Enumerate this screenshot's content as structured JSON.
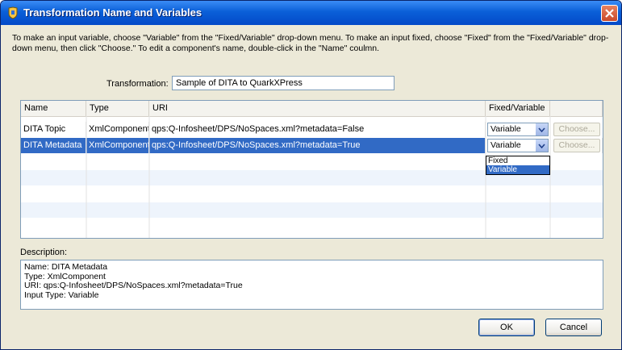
{
  "window": {
    "title": "Transformation Name and Variables"
  },
  "instructions": "To make an input variable, choose \"Variable\" from the \"Fixed/Variable\" drop-down menu. To make an input fixed, choose \"Fixed\" from the \"Fixed/Variable\" drop-down menu, then click \"Choose.\" To edit a component's name, double-click in the \"Name\" coulmn.",
  "transformation": {
    "label": "Transformation:",
    "value": "Sample of DITA to QuarkXPress"
  },
  "grid": {
    "columns": [
      "Name",
      "Type",
      "URI",
      "Fixed/Variable",
      ""
    ],
    "rows": [
      {
        "name": "DITA Topic",
        "type": "XmlComponent",
        "uri": "qps:Q-Infosheet/DPS/NoSpaces.xml?metadata=False",
        "mode": "Variable",
        "choose": "Choose..."
      },
      {
        "name": "DITA Metadata",
        "type": "XmlComponent",
        "uri": "qps:Q-Infosheet/DPS/NoSpaces.xml?metadata=True",
        "mode": "Variable",
        "choose": "Choose..."
      }
    ],
    "dropdown_options": [
      "Fixed",
      "Variable"
    ]
  },
  "description": {
    "label": "Description:",
    "lines": [
      "Name: DITA Metadata",
      "Type: XmlComponent",
      "URI: qps:Q-Infosheet/DPS/NoSpaces.xml?metadata=True",
      "Input Type: Variable"
    ]
  },
  "buttons": {
    "ok": "OK",
    "cancel": "Cancel"
  },
  "colors": {
    "titlebar": "#0a5fd8",
    "selection": "#316ac5",
    "dialog_bg": "#ece9d8"
  }
}
